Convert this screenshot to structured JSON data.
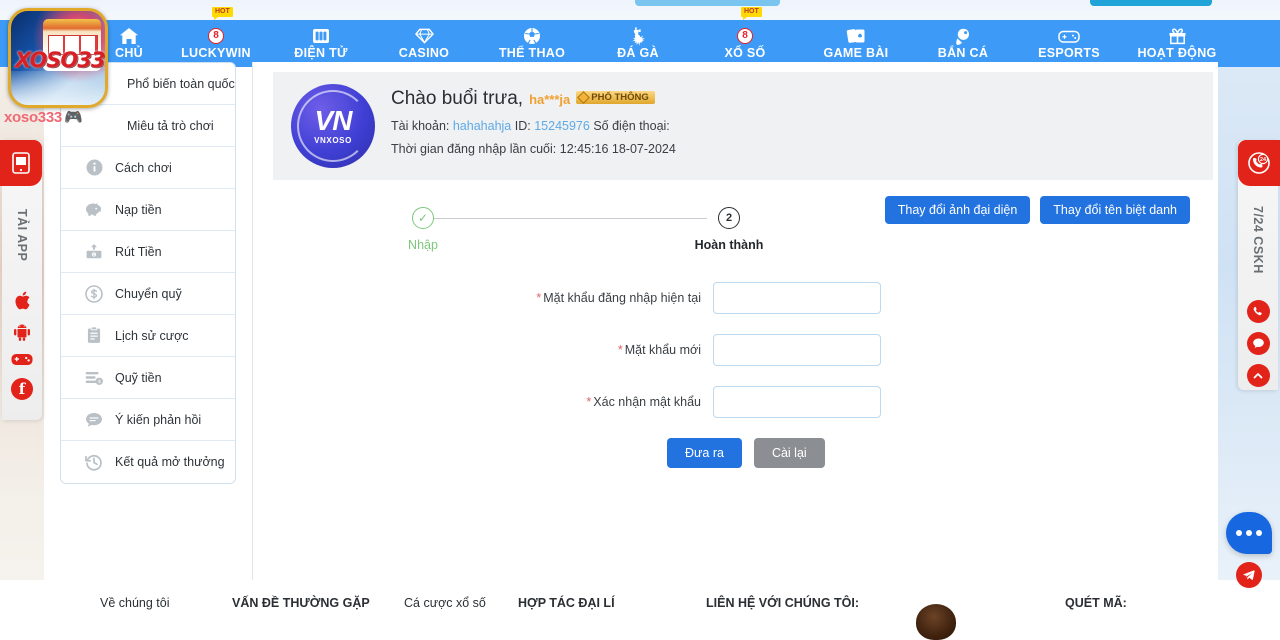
{
  "brand": {
    "logo_text": "XOSO333",
    "sub_text": "xoso333",
    "sub_icon": "gamepad-icon"
  },
  "nav": {
    "items": [
      {
        "label": "CHỦ",
        "icon": "home-icon",
        "badge": "",
        "hot": false
      },
      {
        "label": "LUCKYWIN",
        "icon": "lucky-badge-icon",
        "badge": "8",
        "hot": true
      },
      {
        "label": "ĐIỆN TỬ",
        "icon": "slot-machine-icon",
        "badge": "",
        "hot": false
      },
      {
        "label": "CASINO",
        "icon": "diamond-icon",
        "badge": "",
        "hot": false
      },
      {
        "label": "THỂ THAO",
        "icon": "soccer-ball-icon",
        "badge": "",
        "hot": false
      },
      {
        "label": "ĐÁ GÀ",
        "icon": "rooster-icon",
        "badge": "",
        "hot": false
      },
      {
        "label": "XỔ SỐ",
        "icon": "lottery-badge-icon",
        "badge": "8",
        "hot": true
      },
      {
        "label": "GAME BÀI",
        "icon": "playing-cards-icon",
        "badge": "",
        "hot": false
      },
      {
        "label": "BẮN CÁ",
        "icon": "fishing-icon",
        "badge": "",
        "hot": false
      },
      {
        "label": "ESPORTS",
        "icon": "gamepad-icon",
        "badge": "",
        "hot": false
      },
      {
        "label": "HOẠT ĐỘNG",
        "icon": "gift-icon",
        "badge": "",
        "hot": false
      }
    ]
  },
  "sidebar": {
    "items": [
      {
        "label": "Phổ biến toàn quốc",
        "icon": ""
      },
      {
        "label": "Miêu tả trò chơi",
        "icon": ""
      },
      {
        "label": "Cách chơi",
        "icon": "info-icon"
      },
      {
        "label": "Nạp tiền",
        "icon": "piggy-bank-icon"
      },
      {
        "label": "Rút Tiền",
        "icon": "withdraw-icon"
      },
      {
        "label": "Chuyển quỹ",
        "icon": "transfer-icon"
      },
      {
        "label": "Lịch sử cược",
        "icon": "clipboard-icon"
      },
      {
        "label": "Quỹ tiền",
        "icon": "funds-icon"
      },
      {
        "label": "Ý kiến phản hồi",
        "icon": "chat-icon"
      },
      {
        "label": "Kết quả mở thưởng",
        "icon": "history-icon"
      }
    ]
  },
  "profile": {
    "avatar_initials": "VN",
    "avatar_brand": "VNXOSO",
    "greeting": "Chào buổi trưa,",
    "username_masked": "ha***ja",
    "vip_badge": "PHỔ THÔNG",
    "account_label": "Tài khoản:",
    "account_value": "hahahahja",
    "id_label": "ID:",
    "id_value": "15245976",
    "phone_label": "Số điện thoại:",
    "phone_value": "",
    "last_login_label": "Thời gian đăng nhập lần cuối:",
    "last_login_value": "12:45:16 18-07-2024"
  },
  "top_actions": {
    "change_avatar": "Thay đổi ảnh đại diện",
    "change_nickname": "Thay đổi tên biệt danh"
  },
  "stepper": {
    "step1_label": "Nhập",
    "step1_mark": "✓",
    "step2_label": "Hoàn thành",
    "step2_mark": "2"
  },
  "form": {
    "fields": [
      {
        "label": "Mặt khẩu đăng nhập hiện tại",
        "value": "",
        "placeholder": "",
        "required": "*"
      },
      {
        "label": "Mặt khẩu mới",
        "value": "",
        "placeholder": "",
        "required": "*"
      },
      {
        "label": "Xác nhận mật khẩu",
        "value": "",
        "placeholder": "",
        "required": "*"
      }
    ],
    "submit_label": "Đưa ra",
    "reset_label": "Cài lại"
  },
  "left_widget": {
    "title": "TẢI APP",
    "head_icon": "mobile-app-icon",
    "icons": [
      "apple-icon",
      "android-icon",
      "gamepad-icon",
      "facebook-icon"
    ]
  },
  "right_widget": {
    "title": "7/24 CSKH",
    "head_icon": "support-24-icon",
    "icons": [
      "phone-icon",
      "message-icon",
      "scroll-top-icon"
    ]
  },
  "floating": {
    "chat_icon": "chat-dots-icon",
    "telegram_icon": "telegram-icon"
  },
  "footer": {
    "links": [
      {
        "label": "Về chúng tôi",
        "strong": false
      },
      {
        "label": "VẤN ĐỀ THƯỜNG GẶP",
        "strong": true
      },
      {
        "label": "Cá cược xổ số",
        "strong": false
      },
      {
        "label": "HỢP TÁC ĐẠI LÍ",
        "strong": true
      },
      {
        "label": "LIÊN HỆ VỚI CHÚNG TÔI:",
        "strong": true
      },
      {
        "label": "QUÉT MÃ:",
        "strong": true
      }
    ]
  },
  "colors": {
    "nav_blue": "#3d9bf7",
    "accent_blue": "#2272e0",
    "red": "#e2231a",
    "green": "#7dc77d",
    "gold": "#e0a92a"
  }
}
